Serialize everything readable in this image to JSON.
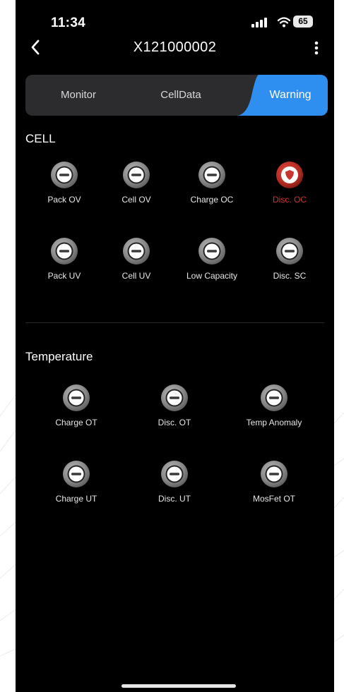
{
  "status_bar": {
    "time": "11:34",
    "battery": "65"
  },
  "nav": {
    "title": "X121000002"
  },
  "tabs": [
    {
      "label": "Monitor",
      "active": false
    },
    {
      "label": "CellData",
      "active": false
    },
    {
      "label": "Warning",
      "active": true
    }
  ],
  "colors": {
    "accent": "#2f8ff0",
    "alert": "#c8362f",
    "indicator": "#8a8a8a",
    "background": "#000000"
  },
  "cell": {
    "title": "CELL",
    "items": [
      {
        "label": "Pack OV",
        "state": "normal"
      },
      {
        "label": "Cell OV",
        "state": "normal"
      },
      {
        "label": "Charge OC",
        "state": "normal"
      },
      {
        "label": "Disc. OC",
        "state": "alert"
      },
      {
        "label": "Pack UV",
        "state": "normal"
      },
      {
        "label": "Cell UV",
        "state": "normal"
      },
      {
        "label": "Low Capacity",
        "state": "normal"
      },
      {
        "label": "Disc. SC",
        "state": "normal"
      }
    ]
  },
  "temperature": {
    "title": "Temperature",
    "items": [
      {
        "label": "Charge OT",
        "state": "normal"
      },
      {
        "label": "Disc. OT",
        "state": "normal"
      },
      {
        "label": "Temp Anomaly",
        "state": "normal"
      },
      {
        "label": "Charge UT",
        "state": "normal"
      },
      {
        "label": "Disc. UT",
        "state": "normal"
      },
      {
        "label": "MosFet OT",
        "state": "normal"
      }
    ]
  }
}
